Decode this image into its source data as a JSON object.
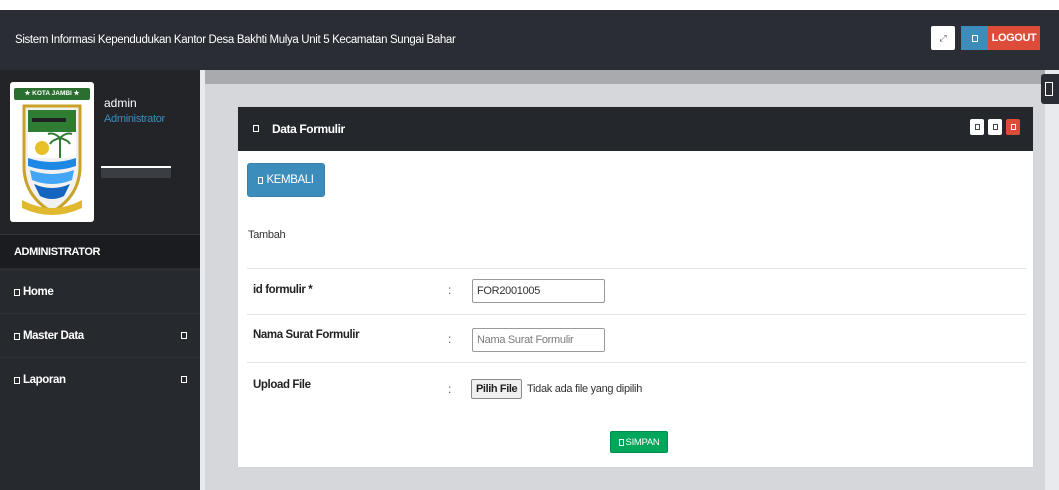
{
  "header": {
    "title": "Sistem Informasi Kependudukan Kantor Desa Bakhti Mulya Unit 5 Kecamatan Sungai Bahar",
    "logout_label": "LOGOUT",
    "fullscreen_glyph": "⤢"
  },
  "sidebar": {
    "logo_ribbon": "★ KOTA JAMBI ★",
    "user_name": "admin",
    "user_role": "Administrator",
    "menu_header": "ADMINISTRATOR",
    "items": [
      {
        "label": "Home",
        "has_caret": false
      },
      {
        "label": "Master Data",
        "has_caret": true
      },
      {
        "label": "Laporan",
        "has_caret": true
      }
    ]
  },
  "panel": {
    "title": "Data Formulir",
    "back_label": "KEMBALI",
    "section_label": "Tambah",
    "fields": [
      {
        "label": "id formulir *",
        "colon": ":",
        "value": "FOR2001005",
        "placeholder": ""
      },
      {
        "label": "Nama Surat Formulir",
        "colon": ":",
        "value": "",
        "placeholder": "Nama Surat Formulir"
      },
      {
        "label": "Upload File",
        "colon": ":",
        "file_button": "Pilih File",
        "file_status": "Tidak ada file yang dipilih"
      }
    ],
    "save_label": "SIMPAN"
  },
  "colors": {
    "header_bg": "#2a2d33",
    "sidebar_bg": "#26292e",
    "primary": "#3c8dbc",
    "danger": "#dd4b39",
    "success": "#00a65a"
  },
  "icons": {
    "fullscreen": "expand-icon",
    "logout": "square-icon",
    "menu_item": "square-icon",
    "caret": "square-icon",
    "panel_title": "square-icon",
    "panel_tools": [
      "minimize-icon",
      "maximize-icon",
      "close-icon"
    ]
  }
}
